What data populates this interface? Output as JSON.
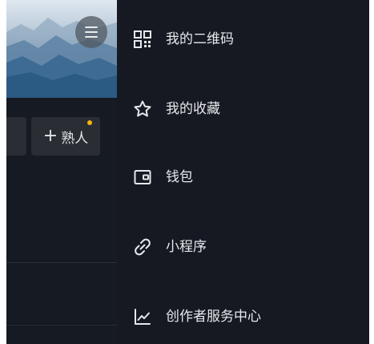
{
  "profile": {
    "add_friend_label": "熟人",
    "add_friend_prefix": "+"
  },
  "drawer": {
    "items": [
      {
        "label": "我的二维码",
        "icon": "qr-code-icon"
      },
      {
        "label": "我的收藏",
        "icon": "star-icon"
      },
      {
        "label": "钱包",
        "icon": "wallet-icon"
      },
      {
        "label": "小程序",
        "icon": "link-icon"
      },
      {
        "label": "创作者服务中心",
        "icon": "chart-icon"
      }
    ]
  },
  "colors": {
    "background": "#111318",
    "drawer": "#161922",
    "chip": "#2a2d33",
    "text": "#e6e8eb",
    "notification_dot": "#f5b40f"
  }
}
